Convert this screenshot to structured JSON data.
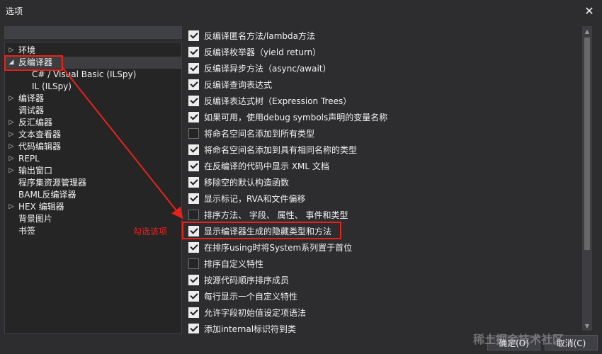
{
  "window": {
    "title": "选项",
    "close_icon": "✕"
  },
  "search": {
    "value": ""
  },
  "tree": [
    {
      "label": "环境",
      "expander": "right"
    },
    {
      "label": "反编译器",
      "expander": "down",
      "selected": true
    },
    {
      "label": "C# / Visual Basic (ILSpy)",
      "expander": "none",
      "child": true
    },
    {
      "label": "IL (ILSpy)",
      "expander": "none",
      "child": true
    },
    {
      "label": "编译器",
      "expander": "right"
    },
    {
      "label": "调试器",
      "expander": "none"
    },
    {
      "label": "反汇编器",
      "expander": "right"
    },
    {
      "label": "文本查看器",
      "expander": "right"
    },
    {
      "label": "代码编辑器",
      "expander": "right"
    },
    {
      "label": "REPL",
      "expander": "right"
    },
    {
      "label": "输出窗口",
      "expander": "right"
    },
    {
      "label": "程序集资源管理器",
      "expander": "none"
    },
    {
      "label": "BAML反编译器",
      "expander": "none"
    },
    {
      "label": "HEX 编辑器",
      "expander": "right"
    },
    {
      "label": "背景图片",
      "expander": "none"
    },
    {
      "label": "书签",
      "expander": "none"
    }
  ],
  "options": [
    {
      "label": "反编译匿名方法/lambda方法",
      "checked": true
    },
    {
      "label": "反编译枚举器（yield return）",
      "checked": true
    },
    {
      "label": "反编译异步方法（async/await）",
      "checked": true
    },
    {
      "label": "反编译查询表达式",
      "checked": true
    },
    {
      "label": "反编译表达式树（Expression Trees）",
      "checked": true
    },
    {
      "label": "如果可用，使用debug symbols声明的变量名称",
      "checked": true
    },
    {
      "label": "将命名空间名添加到所有类型",
      "checked": false
    },
    {
      "label": "将命名空间名添加到具有相同名称的类型",
      "checked": true
    },
    {
      "label": "在反编译的代码中显示 XML 文档",
      "checked": true
    },
    {
      "label": "移除空的默认构造函数",
      "checked": true
    },
    {
      "label": "显示标记，RVA和文件偏移",
      "checked": true
    },
    {
      "label": "排序方法、 字段、 属性、 事件和类型",
      "checked": false
    },
    {
      "label": "显示编译器生成的隐藏类型和方法",
      "checked": true
    },
    {
      "label": "在排序using时将System系列置于首位",
      "checked": true
    },
    {
      "label": "排序自定义特性",
      "checked": false
    },
    {
      "label": "按源代码顺序排序成员",
      "checked": true
    },
    {
      "label": "每行显示一个自定义特性",
      "checked": true
    },
    {
      "label": "允许字段初始值设定项语法",
      "checked": true
    },
    {
      "label": "添加internal标识符到类",
      "checked": true
    }
  ],
  "buttons": {
    "ok": "确定(O)",
    "cancel": "取消(C)"
  },
  "annotation": {
    "text": "勾选该项",
    "color": "#e8221b"
  },
  "watermark": "稀土掘金技术社区"
}
